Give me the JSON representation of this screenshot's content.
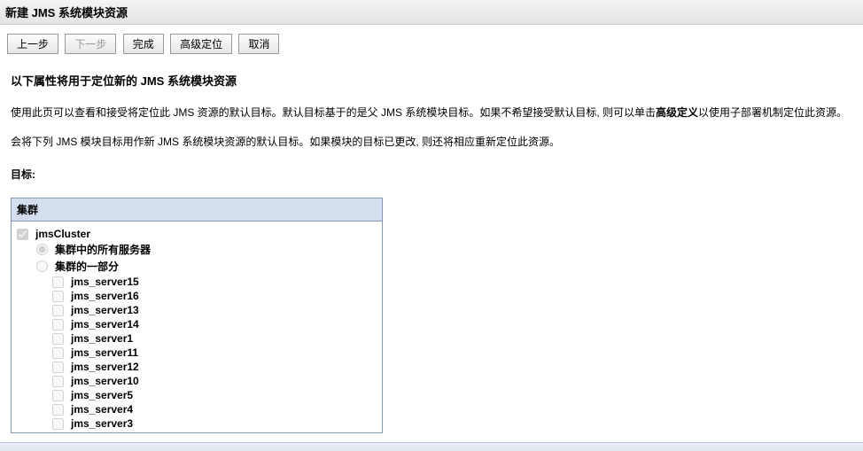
{
  "header": {
    "title": "新建 JMS 系统模块资源"
  },
  "buttons": {
    "back": "上一步",
    "next": "下一步",
    "finish": "完成",
    "advanced": "高级定位",
    "cancel": "取消"
  },
  "section": {
    "heading": "以下属性将用于定位新的 JMS 系统模块资源",
    "desc1_a": "使用此页可以查看和接受将定位此 JMS 资源的默认目标。默认目标基于的是父 JMS 系统模块目标。如果不希望接受默认目标, 则可以单击",
    "desc1_bold": "高级定义",
    "desc1_b": "以使用子部署机制定位此资源。",
    "desc2": "会将下列 JMS 模块目标用作新 JMS 系统模块资源的默认目标。如果模块的目标已更改, 则还将相应重新定位此资源。",
    "targets_label": "目标:"
  },
  "targets": {
    "group_header": "集群",
    "cluster": {
      "name": "jmsCluster",
      "checked": true,
      "radios": {
        "all_label": "集群中的所有服务器",
        "part_label": "集群的一部分",
        "selected": "all"
      },
      "servers": [
        {
          "name": "jms_server15"
        },
        {
          "name": "jms_server16"
        },
        {
          "name": "jms_server13"
        },
        {
          "name": "jms_server14"
        },
        {
          "name": "jms_server1"
        },
        {
          "name": "jms_server11"
        },
        {
          "name": "jms_server12"
        },
        {
          "name": "jms_server10"
        },
        {
          "name": "jms_server5"
        },
        {
          "name": "jms_server4"
        },
        {
          "name": "jms_server3"
        }
      ]
    }
  }
}
